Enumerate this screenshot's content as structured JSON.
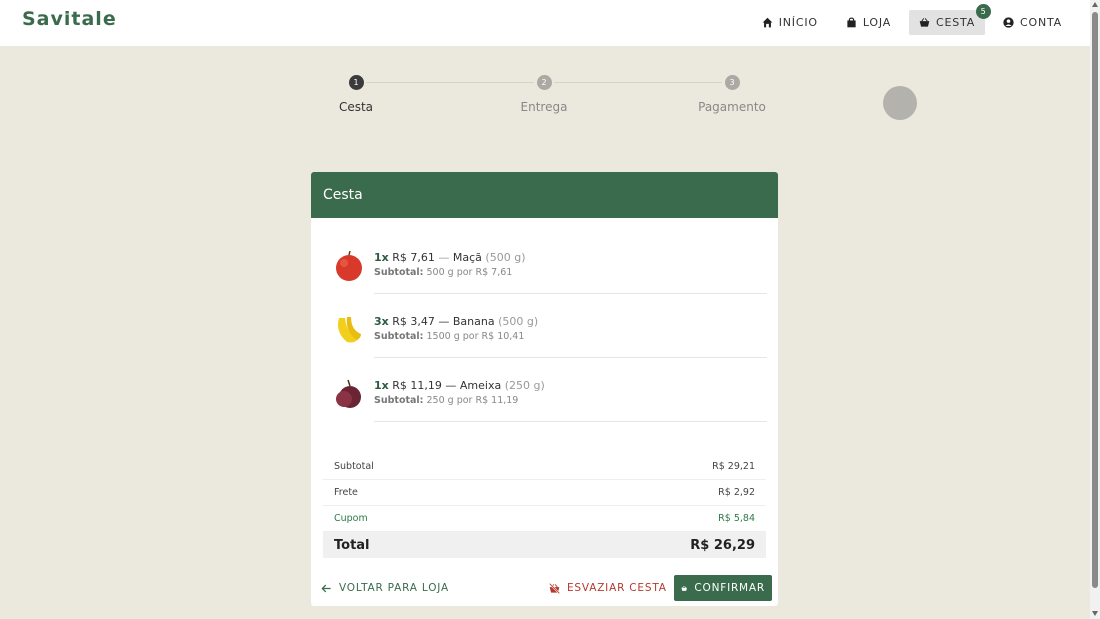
{
  "brand": {
    "logo": "Savitale"
  },
  "nav": {
    "items": [
      {
        "label": "INÍCIO",
        "icon": "home-icon"
      },
      {
        "label": "LOJA",
        "icon": "shopping-bag-icon"
      },
      {
        "label": "CESTA",
        "icon": "basket-icon",
        "badge": "5",
        "active": true
      },
      {
        "label": "CONTA",
        "icon": "account-icon"
      }
    ]
  },
  "stepper": {
    "steps": [
      {
        "number": "1",
        "label": "Cesta",
        "state": "current"
      },
      {
        "number": "2",
        "label": "Entrega",
        "state": "pending"
      },
      {
        "number": "3",
        "label": "Pagamento",
        "state": "pending"
      }
    ]
  },
  "cart": {
    "title": "Cesta",
    "items": [
      {
        "qty": "1x",
        "price": "R$ 7,61",
        "sep": "—",
        "name": "Maçã",
        "weight": "(500 g)",
        "subtotal_label": "Subtotal:",
        "subtotal_text": "500 g por R$ 7,61",
        "icon": "apple-icon"
      },
      {
        "qty": "3x",
        "price": "R$ 3,47",
        "sep": "—",
        "name": "Banana",
        "weight": "(500 g)",
        "subtotal_label": "Subtotal:",
        "subtotal_text": "1500 g por R$ 10,41",
        "icon": "banana-icon"
      },
      {
        "qty": "1x",
        "price": "R$ 11,19",
        "sep": "—",
        "name": "Ameixa",
        "weight": "(250 g)",
        "subtotal_label": "Subtotal:",
        "subtotal_text": "250 g por R$ 11,19",
        "icon": "plum-icon"
      }
    ],
    "summary": {
      "subtotal": {
        "label": "Subtotal",
        "value": "R$ 29,21"
      },
      "shipping": {
        "label": "Frete",
        "value": "R$ 2,92"
      },
      "coupon": {
        "label": "Cupom",
        "value": "R$ 5,84"
      },
      "total": {
        "label": "Total",
        "value": "R$ 26,29"
      }
    },
    "actions": {
      "back": "VOLTAR PARA LOJA",
      "empty": "ESVAZIAR CESTA",
      "confirm": "CONFIRMAR"
    }
  },
  "colors": {
    "brand": "#3a6b4d",
    "danger": "#b33a2f",
    "background": "#ebe9dd"
  }
}
